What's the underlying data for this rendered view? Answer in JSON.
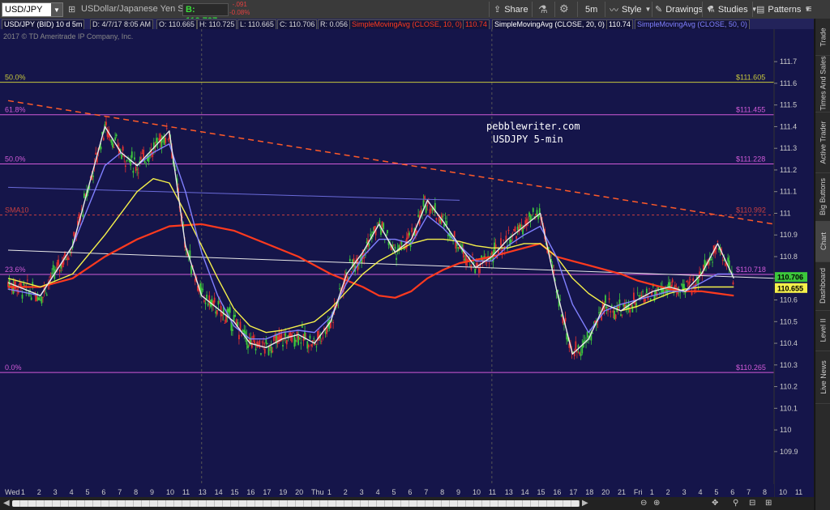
{
  "toolbar": {
    "symbol": "USD/JPY",
    "description": "USDollar/Japanese Yen Spot",
    "bid_label": "B: 110.707",
    "change_abs": "-.091",
    "change_pct": "-0.08%",
    "share": "Share",
    "timeframe": "5m",
    "style": "Style",
    "drawings": "Drawings",
    "studies": "Studies",
    "patterns": "Patterns"
  },
  "infobar": {
    "chart_id": "USD/JPY (BID) 10 d 5m",
    "date": "D: 4/7/17 8:05 AM",
    "open": "O: 110.665",
    "high": "H: 110.725",
    "low": "L: 110.665",
    "close": "C: 110.706",
    "range": "R: 0.056",
    "sma10": "SimpleMovingAvg (CLOSE, 10, 0)",
    "sma10_val": "110.74",
    "sma20": "SimpleMovingAvg (CLOSE, 20, 0)",
    "sma20_val": "110.74",
    "sma50": "SimpleMovingAvg (CLOSE, 50, 0)"
  },
  "copyright": "2017 © TD Ameritrade IP Company, Inc.",
  "watermark": [
    "pebblewriter.com",
    "USDJPY 5-min"
  ],
  "sidebar": [
    "Trade",
    "Times And Sales",
    "Active Trader",
    "Big Buttons",
    "Chart",
    "Dashboard",
    "Level II",
    "Live News"
  ],
  "colors": {
    "background": "#15154a",
    "fib": "#d05ad8",
    "fib50top": "#c8c83c",
    "sma_red": "#ff3a1e",
    "sma_yellow": "#f5f04a",
    "sma_blue": "#8080ff",
    "sma_white": "#e8e8e8",
    "trend": "#ff5a28",
    "candle_up": "#3cc83c",
    "candle_down": "#e03030"
  },
  "chart_data": {
    "type": "line",
    "title": "",
    "ylim": [
      109.75,
      111.85
    ],
    "y_ticks": [
      "111.7",
      "111.6",
      "111.5",
      "111.4",
      "111.3",
      "111.2",
      "111.1",
      "111",
      "110.9",
      "110.8",
      "110.7",
      "110.6",
      "110.5",
      "110.4",
      "110.3",
      "110.2",
      "110.1",
      "110",
      "109.9"
    ],
    "x_ticks": [
      "Wed",
      "1",
      "2",
      "3",
      "4",
      "5",
      "6",
      "7",
      "8",
      "9",
      "10",
      "11",
      "13",
      "14",
      "15",
      "16",
      "17",
      "19",
      "20",
      "Thu",
      "1",
      "2",
      "3",
      "4",
      "5",
      "6",
      "7",
      "8",
      "9",
      "10",
      "11",
      "13",
      "14",
      "15",
      "16",
      "17",
      "18",
      "20",
      "21",
      "Fri",
      "1",
      "2",
      "3",
      "4",
      "5",
      "6",
      "7",
      "8",
      "10",
      "11"
    ],
    "fib_levels": [
      {
        "label": "50.0%",
        "price": 111.605,
        "right": "$111.605"
      },
      {
        "label": "61.8%",
        "price": 111.455,
        "right": "$111.455"
      },
      {
        "label": "50.0%",
        "price": 111.228,
        "right": "$111.228"
      },
      {
        "label": "SMA10",
        "price": 110.992,
        "right": "$110.992"
      },
      {
        "label": "23.6%",
        "price": 110.718,
        "right": "$110.718"
      },
      {
        "label": "0.0%",
        "price": 110.265,
        "right": "$110.265"
      }
    ],
    "price_tags": [
      {
        "text": "110.706",
        "price": 110.706,
        "color": "#3cc83c"
      },
      {
        "text": "110.655",
        "price": 110.655,
        "color": "#f5f04a"
      }
    ],
    "series": [
      {
        "color": "#e8e8e8",
        "points": [
          [
            0,
            110.68
          ],
          [
            2,
            110.62
          ],
          [
            4,
            110.85
          ],
          [
            6,
            111.4
          ],
          [
            7,
            111.28
          ],
          [
            8,
            111.22
          ],
          [
            9,
            111.3
          ],
          [
            10,
            111.38
          ],
          [
            11,
            110.85
          ],
          [
            12,
            110.62
          ],
          [
            13,
            110.56
          ],
          [
            14,
            110.5
          ],
          [
            15,
            110.4
          ],
          [
            16,
            110.38
          ],
          [
            17,
            110.42
          ],
          [
            18,
            110.44
          ],
          [
            19,
            110.4
          ],
          [
            20,
            110.5
          ],
          [
            21,
            110.72
          ],
          [
            22,
            110.82
          ],
          [
            23,
            110.95
          ],
          [
            24,
            110.82
          ],
          [
            25,
            110.88
          ],
          [
            26,
            111.06
          ],
          [
            27,
            110.96
          ],
          [
            28,
            110.85
          ],
          [
            29,
            110.75
          ],
          [
            30,
            110.8
          ],
          [
            31,
            110.88
          ],
          [
            32,
            110.94
          ],
          [
            33,
            111.0
          ],
          [
            34,
            110.65
          ],
          [
            35,
            110.35
          ],
          [
            36,
            110.42
          ],
          [
            37,
            110.58
          ],
          [
            38,
            110.55
          ],
          [
            39,
            110.6
          ],
          [
            40,
            110.64
          ],
          [
            41,
            110.66
          ],
          [
            42,
            110.64
          ],
          [
            43,
            110.72
          ],
          [
            44,
            110.86
          ],
          [
            45,
            110.7
          ]
        ]
      },
      {
        "color": "#8080ff",
        "points": [
          [
            0,
            110.65
          ],
          [
            2,
            110.62
          ],
          [
            4,
            110.85
          ],
          [
            6,
            111.22
          ],
          [
            7,
            111.28
          ],
          [
            8,
            111.22
          ],
          [
            9,
            111.28
          ],
          [
            10,
            111.32
          ],
          [
            11,
            111.1
          ],
          [
            12,
            110.82
          ],
          [
            13,
            110.62
          ],
          [
            14,
            110.48
          ],
          [
            15,
            110.42
          ],
          [
            16,
            110.42
          ],
          [
            17,
            110.45
          ],
          [
            18,
            110.46
          ],
          [
            19,
            110.45
          ],
          [
            20,
            110.52
          ],
          [
            21,
            110.68
          ],
          [
            22,
            110.8
          ],
          [
            23,
            110.88
          ],
          [
            24,
            110.88
          ],
          [
            25,
            110.86
          ],
          [
            26,
            110.99
          ],
          [
            27,
            110.93
          ],
          [
            28,
            110.85
          ],
          [
            29,
            110.78
          ],
          [
            30,
            110.78
          ],
          [
            31,
            110.85
          ],
          [
            32,
            110.9
          ],
          [
            33,
            110.94
          ],
          [
            34,
            110.8
          ],
          [
            35,
            110.58
          ],
          [
            36,
            110.45
          ],
          [
            37,
            110.55
          ],
          [
            38,
            110.58
          ],
          [
            39,
            110.6
          ],
          [
            40,
            110.62
          ],
          [
            41,
            110.64
          ],
          [
            42,
            110.64
          ],
          [
            43,
            110.68
          ],
          [
            44,
            110.72
          ],
          [
            45,
            110.72
          ]
        ]
      },
      {
        "color": "#f5f04a",
        "points": [
          [
            0,
            110.7
          ],
          [
            2,
            110.66
          ],
          [
            4,
            110.72
          ],
          [
            6,
            110.9
          ],
          [
            8,
            111.1
          ],
          [
            9,
            111.16
          ],
          [
            10,
            111.14
          ],
          [
            11,
            111.0
          ],
          [
            12,
            110.85
          ],
          [
            13,
            110.7
          ],
          [
            14,
            110.56
          ],
          [
            15,
            110.48
          ],
          [
            16,
            110.45
          ],
          [
            17,
            110.46
          ],
          [
            18,
            110.48
          ],
          [
            19,
            110.5
          ],
          [
            20,
            110.56
          ],
          [
            21,
            110.64
          ],
          [
            22,
            110.72
          ],
          [
            23,
            110.78
          ],
          [
            24,
            110.82
          ],
          [
            25,
            110.86
          ],
          [
            26,
            110.88
          ],
          [
            27,
            110.88
          ],
          [
            28,
            110.87
          ],
          [
            29,
            110.85
          ],
          [
            30,
            110.84
          ],
          [
            31,
            110.84
          ],
          [
            32,
            110.86
          ],
          [
            33,
            110.86
          ],
          [
            34,
            110.8
          ],
          [
            35,
            110.7
          ],
          [
            36,
            110.63
          ],
          [
            37,
            110.58
          ],
          [
            38,
            110.55
          ],
          [
            39,
            110.57
          ],
          [
            40,
            110.6
          ],
          [
            41,
            110.63
          ],
          [
            42,
            110.65
          ],
          [
            43,
            110.66
          ],
          [
            44,
            110.66
          ],
          [
            45,
            110.66
          ]
        ]
      },
      {
        "color": "#ff3a1e",
        "points": [
          [
            0,
            110.66
          ],
          [
            2,
            110.66
          ],
          [
            4,
            110.7
          ],
          [
            6,
            110.8
          ],
          [
            8,
            110.88
          ],
          [
            10,
            110.94
          ],
          [
            12,
            110.95
          ],
          [
            14,
            110.92
          ],
          [
            16,
            110.86
          ],
          [
            18,
            110.8
          ],
          [
            20,
            110.72
          ],
          [
            22,
            110.66
          ],
          [
            23,
            110.62
          ],
          [
            24,
            110.61
          ],
          [
            25,
            110.64
          ],
          [
            26,
            110.7
          ],
          [
            27,
            110.74
          ],
          [
            28,
            110.77
          ],
          [
            30,
            110.8
          ],
          [
            32,
            110.84
          ],
          [
            33,
            110.86
          ],
          [
            34,
            110.8
          ],
          [
            35,
            110.78
          ],
          [
            36,
            110.76
          ],
          [
            37,
            110.74
          ],
          [
            38,
            110.72
          ],
          [
            39,
            110.69
          ],
          [
            40,
            110.67
          ],
          [
            41,
            110.65
          ],
          [
            42,
            110.64
          ],
          [
            43,
            110.64
          ],
          [
            44,
            110.63
          ],
          [
            45,
            110.62
          ]
        ]
      }
    ],
    "trendlines": [
      {
        "color": "#ff5a28",
        "dash": true,
        "from": [
          0,
          111.52
        ],
        "to": [
          47.5,
          110.95
        ]
      },
      {
        "color": "#e8e8e8",
        "dash": false,
        "from": [
          0,
          110.83
        ],
        "to": [
          47.5,
          110.7
        ]
      },
      {
        "color": "#6a6ad8",
        "dash": false,
        "from": [
          0,
          111.12
        ],
        "to": [
          28,
          111.06
        ]
      }
    ]
  }
}
